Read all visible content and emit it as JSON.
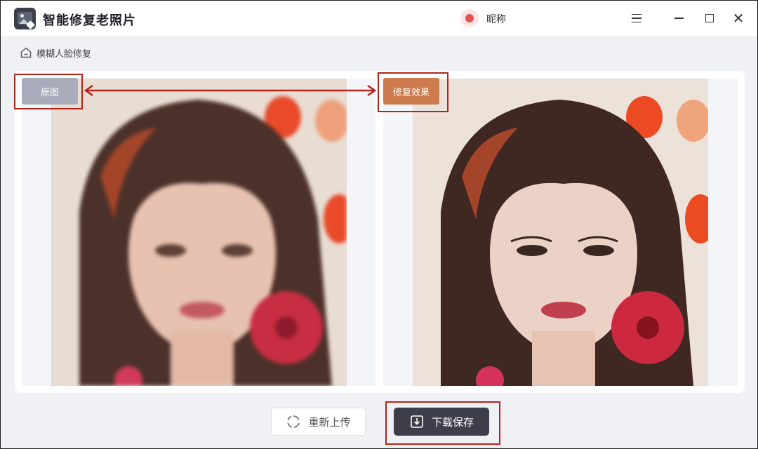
{
  "app": {
    "title": "智能修复老照片",
    "user_name": "昵称"
  },
  "breadcrumb": {
    "label": "模糊人脸修复"
  },
  "compare": {
    "original_label": "原图",
    "result_label": "修复效果"
  },
  "actions": {
    "reupload_label": "重新上传",
    "download_label": "下载保存"
  },
  "colors": {
    "original_tag": "#a9adbb",
    "result_tag": "#cd7b4e",
    "download_button": "#3d3e49",
    "annotation": "#b32418"
  }
}
